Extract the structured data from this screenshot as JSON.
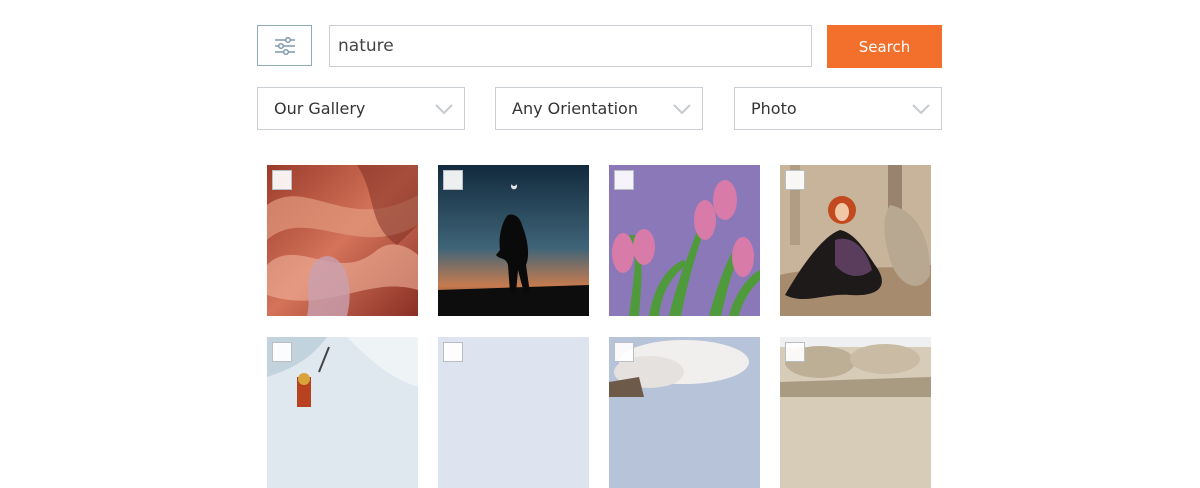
{
  "search": {
    "value": "nature",
    "button_label": "Search"
  },
  "filters": [
    {
      "label": "Our Gallery"
    },
    {
      "label": "Any Orientation"
    },
    {
      "label": "Photo"
    }
  ],
  "gallery": {
    "images": [
      {
        "subject": "red sandstone canyon",
        "selected": false
      },
      {
        "subject": "silhouette couple at dusk",
        "selected": false
      },
      {
        "subject": "pink tulips",
        "selected": false
      },
      {
        "subject": "red-haired woman in forest",
        "selected": false
      },
      {
        "subject": "ice climber",
        "selected": false
      },
      {
        "subject": "pale sky",
        "selected": false
      },
      {
        "subject": "clouds",
        "selected": false
      },
      {
        "subject": "rocks",
        "selected": false
      }
    ]
  },
  "colors": {
    "accent": "#f26f2c",
    "border": "#c9cfd3",
    "filter_border": "#8fa9bd"
  }
}
